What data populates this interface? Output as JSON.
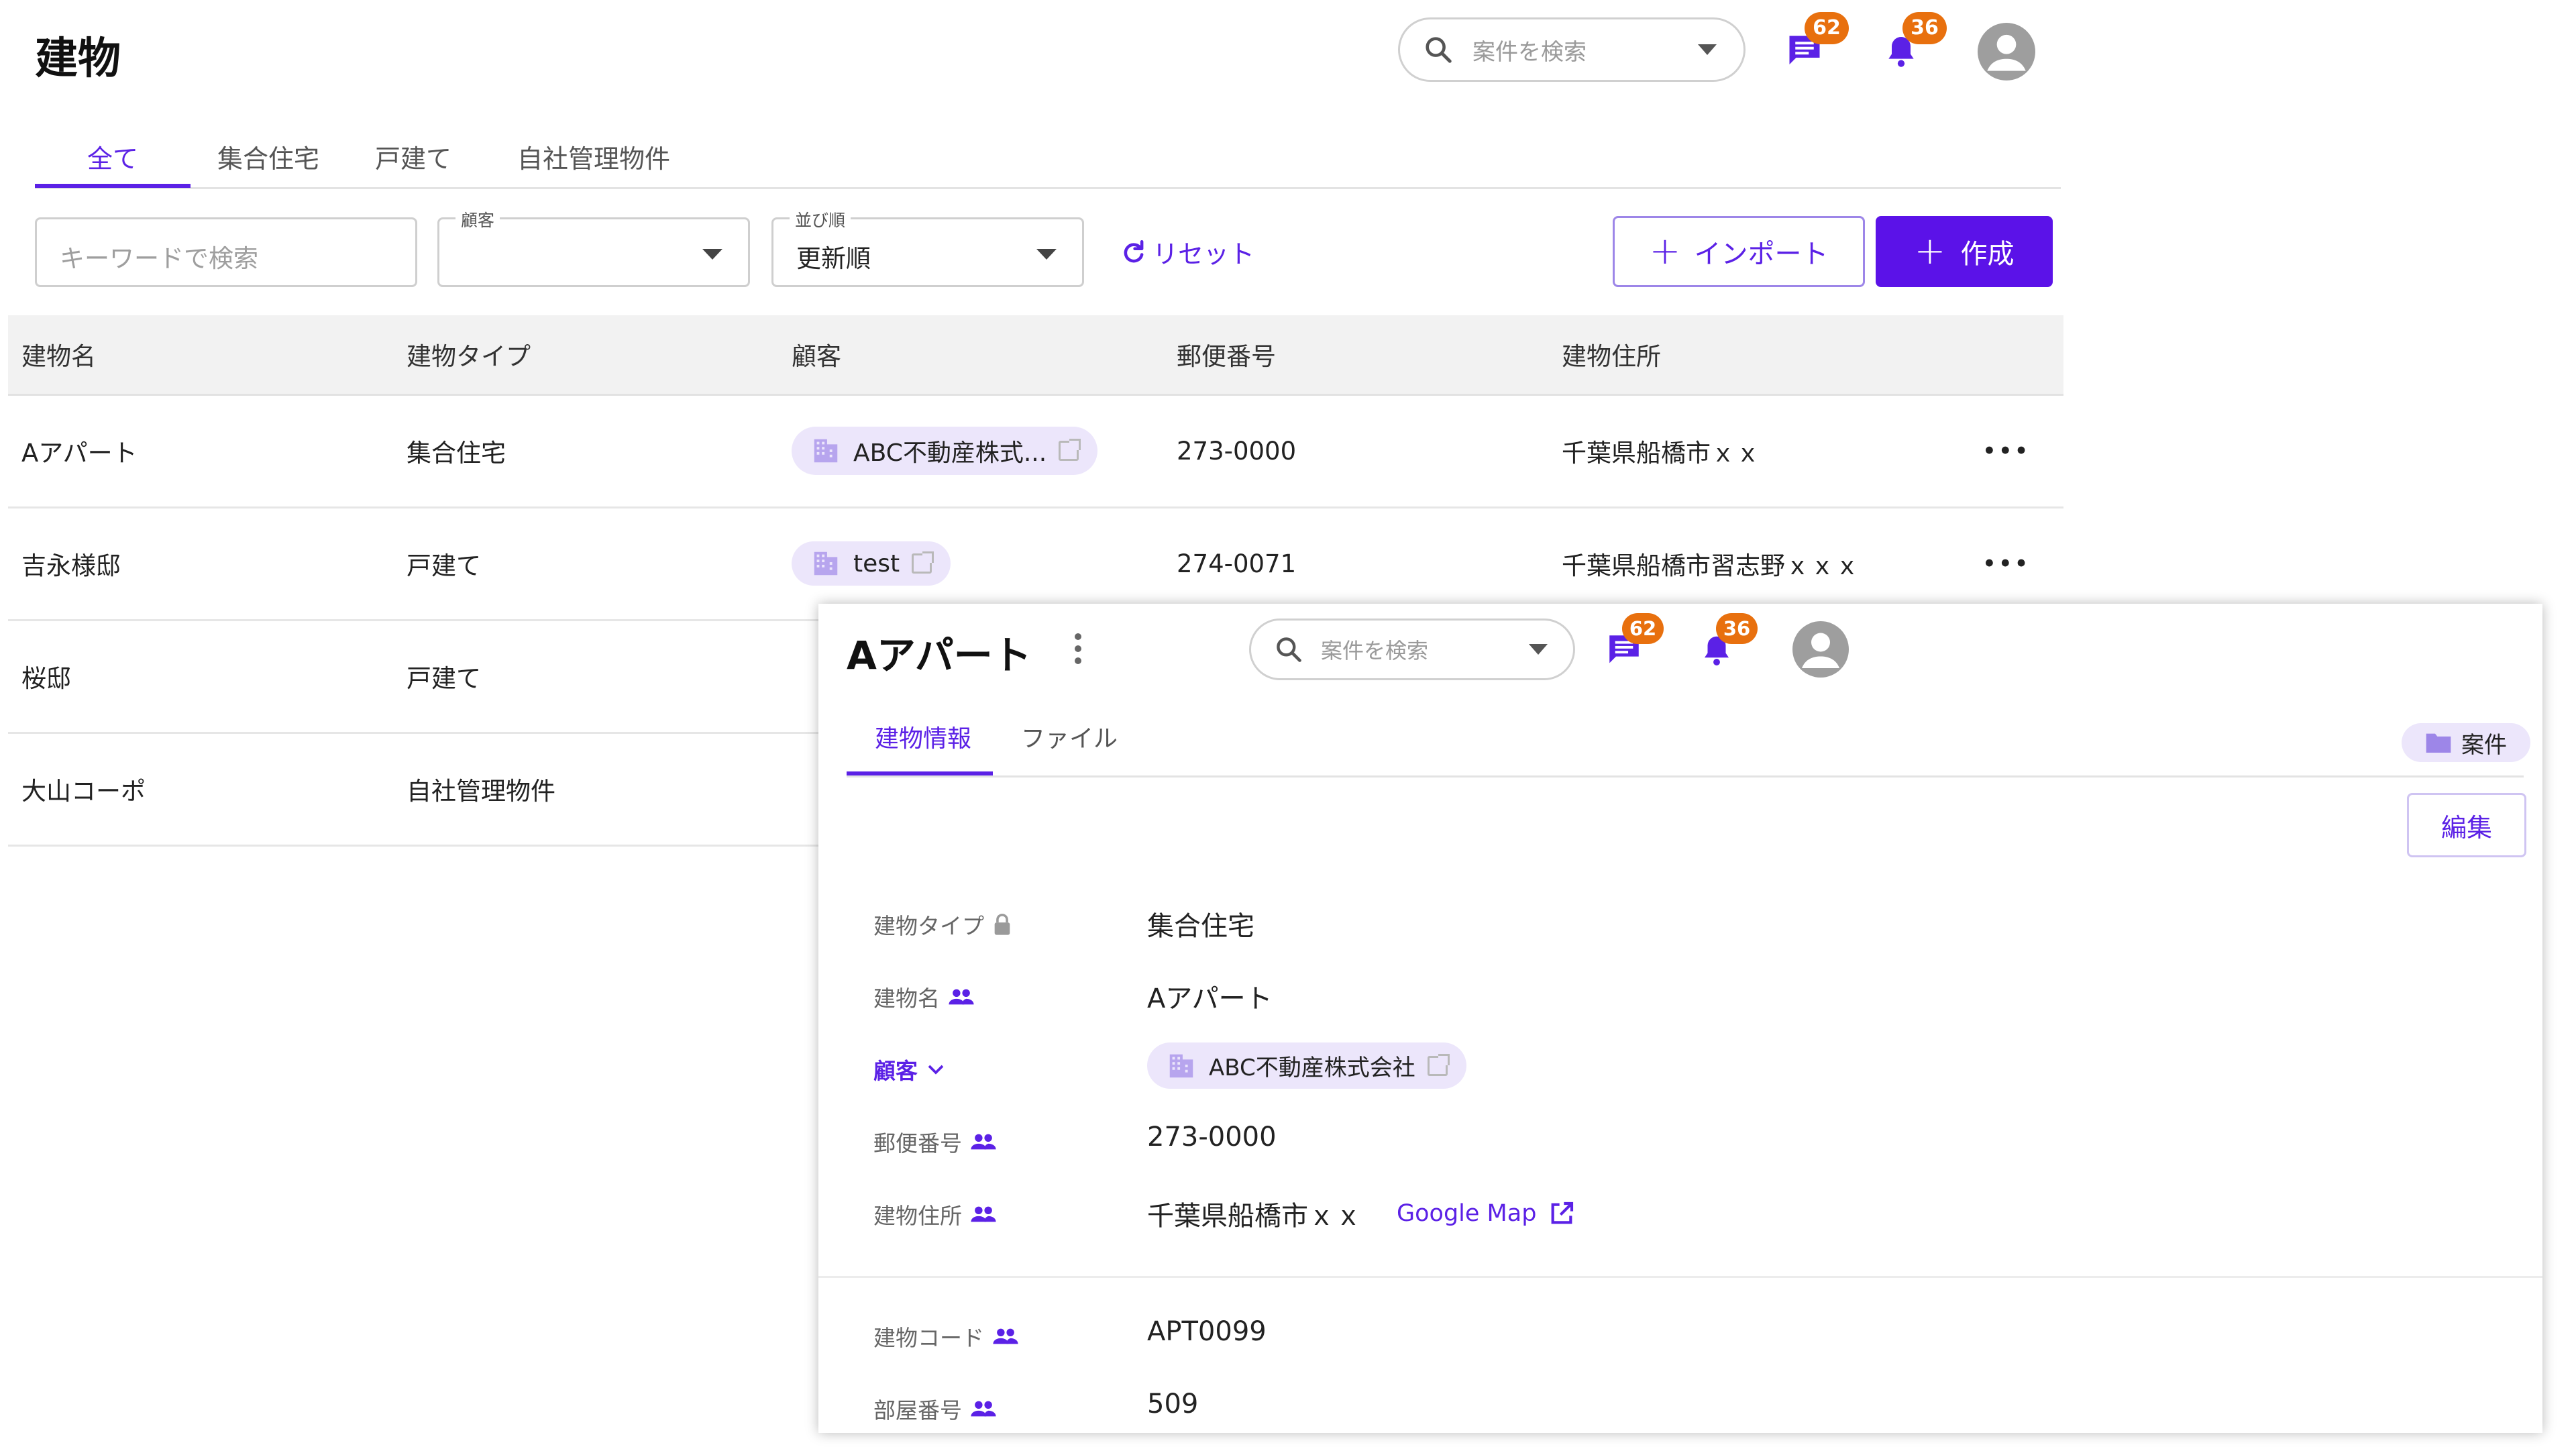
{
  "page": {
    "title": "建物",
    "search_placeholder": "案件を検索",
    "chat_badge": "62",
    "bell_badge": "36"
  },
  "tabs": [
    "全て",
    "集合住宅",
    "戸建て",
    "自社管理物件"
  ],
  "filters": {
    "keyword_placeholder": "キーワードで検索",
    "customer_label": "顧客",
    "customer_value": "",
    "sort_label": "並び順",
    "sort_value": "更新順",
    "reset_label": "リセット",
    "import_label": "インポート",
    "create_label": "作成"
  },
  "table": {
    "columns": [
      "建物名",
      "建物タイプ",
      "顧客",
      "郵便番号",
      "建物住所"
    ],
    "rows": [
      {
        "name": "Aアパート",
        "type": "集合住宅",
        "customer": "ABC不動産株式...",
        "postal": "273-0000",
        "address": "千葉県船橋市ｘｘ"
      },
      {
        "name": "吉永様邸",
        "type": "戸建て",
        "customer": "test",
        "postal": "274-0071",
        "address": "千葉県船橋市習志野ｘｘｘ"
      },
      {
        "name": "桜邸",
        "type": "戸建て",
        "customer": "",
        "postal": "",
        "address": ""
      },
      {
        "name": "大山コーポ",
        "type": "自社管理物件",
        "customer": "",
        "postal": "",
        "address": ""
      }
    ]
  },
  "detail": {
    "title": "Aアパート",
    "search_placeholder": "案件を検索",
    "chat_badge": "62",
    "bell_badge": "36",
    "tabs": [
      "建物情報",
      "ファイル"
    ],
    "case_chip": "案件",
    "edit_label": "編集",
    "fields": [
      {
        "label": "建物タイプ",
        "value": "集合住宅"
      },
      {
        "label": "建物名",
        "value": "Aアパート"
      },
      {
        "label": "顧客",
        "value": "ABC不動産株式会社"
      },
      {
        "label": "郵便番号",
        "value": "273-0000"
      },
      {
        "label": "建物住所",
        "value": "千葉県船橋市ｘｘ",
        "link": "Google Map"
      },
      {
        "label": "建物コード",
        "value": "APT0099"
      },
      {
        "label": "部屋番号",
        "value": "509"
      }
    ]
  },
  "colors": {
    "accent": "#5b21e6",
    "primary_button": "#5b12e8",
    "badge": "#e8700e",
    "chip_bg": "#ece6fb"
  }
}
